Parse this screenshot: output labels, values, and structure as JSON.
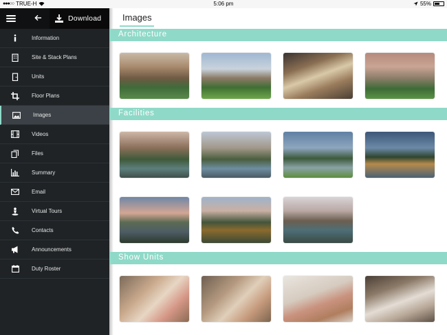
{
  "status": {
    "carrier": "TRUE-H",
    "time": "5:06 pm",
    "battery": "55%"
  },
  "topbar": {
    "download_label": "Download"
  },
  "sidebar": {
    "items": [
      {
        "label": "Information",
        "icon": "info-icon"
      },
      {
        "label": "Site & Stack Plans",
        "icon": "building-icon"
      },
      {
        "label": "Units",
        "icon": "door-icon"
      },
      {
        "label": "Floor Plans",
        "icon": "crop-icon"
      },
      {
        "label": "Images",
        "icon": "image-icon",
        "active": true
      },
      {
        "label": "Videos",
        "icon": "film-icon"
      },
      {
        "label": "Files",
        "icon": "files-icon"
      },
      {
        "label": "Summary",
        "icon": "bar-chart-icon"
      },
      {
        "label": "Email",
        "icon": "envelope-icon"
      },
      {
        "label": "Virtual Tours",
        "icon": "person-icon"
      },
      {
        "label": "Contacts",
        "icon": "phone-icon"
      },
      {
        "label": "Announcements",
        "icon": "megaphone-icon"
      },
      {
        "label": "Duty Roster",
        "icon": "calendar-icon"
      }
    ]
  },
  "main": {
    "title": "Images",
    "sections": [
      {
        "label": "Architecture"
      },
      {
        "label": "Facilities"
      },
      {
        "label": "Show Units"
      }
    ]
  },
  "colors": {
    "accent": "#8fd9c8",
    "sidebar_bg": "#1f2326",
    "topbar_bg": "#0f1112"
  }
}
